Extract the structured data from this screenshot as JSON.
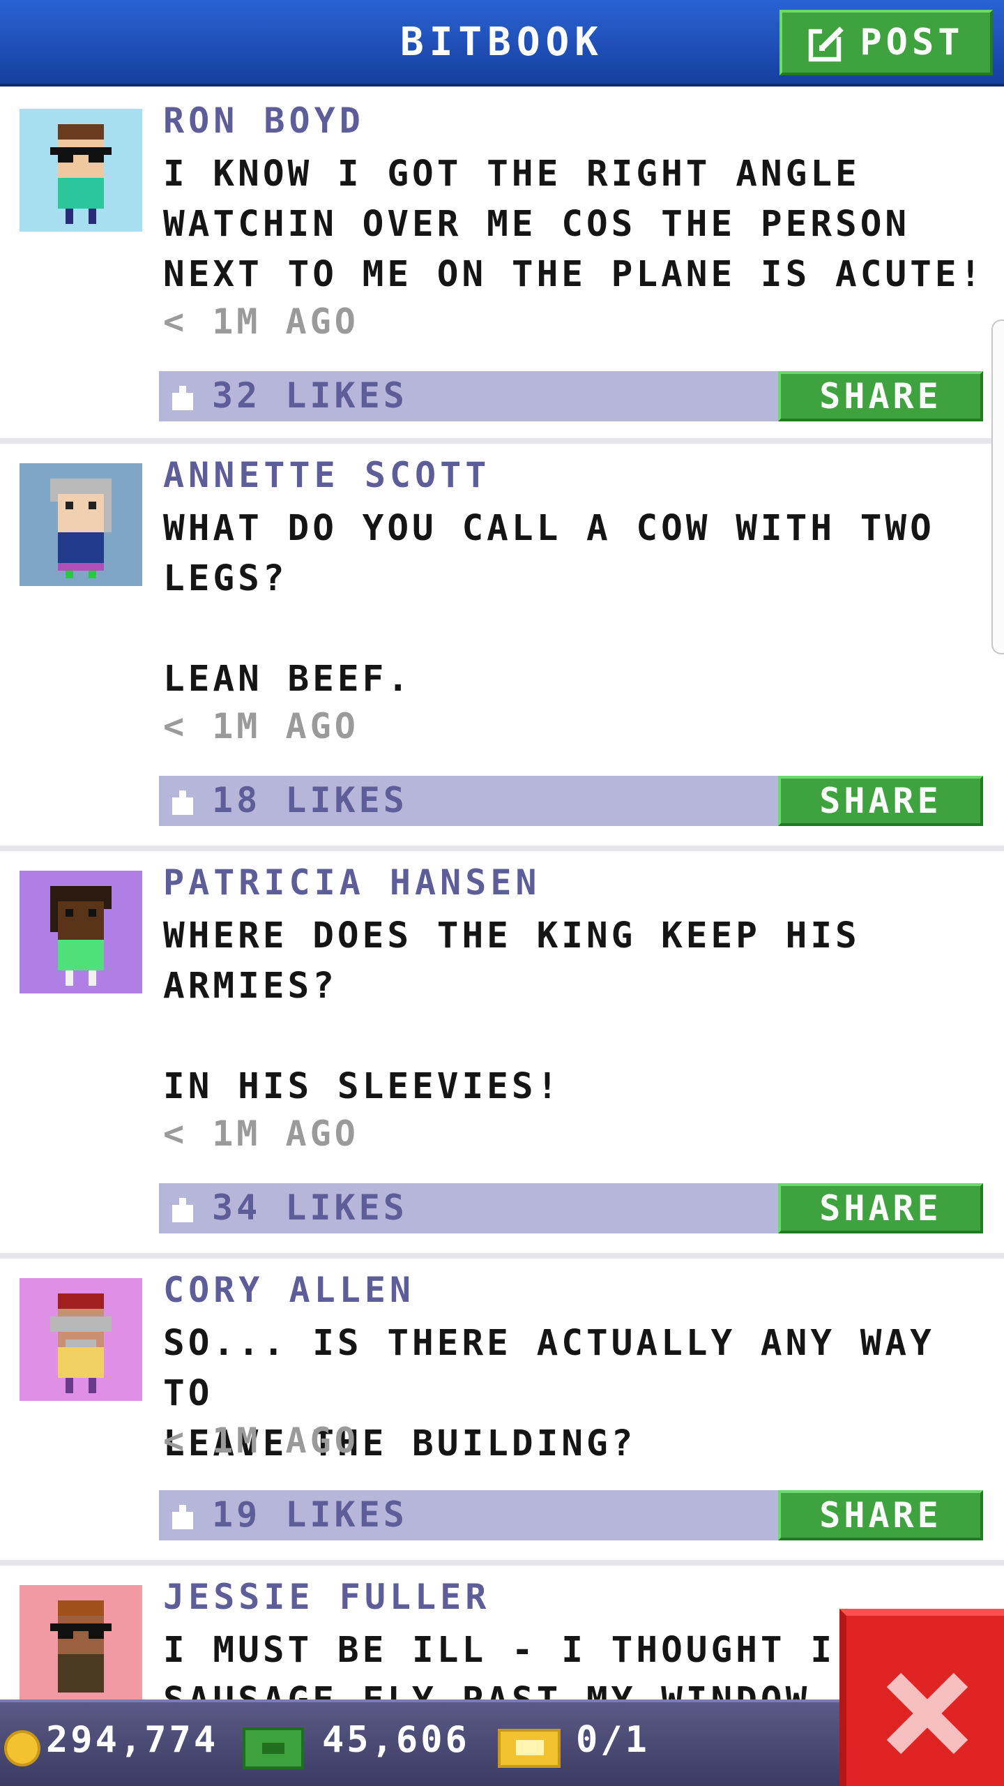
{
  "header": {
    "title": "BITBOOK",
    "post_label": "POST"
  },
  "posts": [
    {
      "author": "RON BOYD",
      "text": "I KNOW I GOT THE RIGHT ANGLE\nWATCHIN OVER ME COS THE PERSON\nNEXT TO ME ON THE PLANE IS ACUTE!",
      "time": "< 1M AGO",
      "likes": "32 LIKES",
      "share_label": "SHARE",
      "avatar_bg": "#a8dff0"
    },
    {
      "author": "ANNETTE SCOTT",
      "text": "WHAT DO YOU CALL A COW WITH TWO\nLEGS?\n\nLEAN BEEF.",
      "time": "< 1M AGO",
      "likes": "18 LIKES",
      "share_label": "SHARE",
      "avatar_bg": "#7fa6c7"
    },
    {
      "author": "PATRICIA HANSEN",
      "text": "WHERE DOES THE KING KEEP HIS\nARMIES?\n\nIN HIS SLEEVIES!",
      "time": "< 1M AGO",
      "likes": "34 LIKES",
      "share_label": "SHARE",
      "avatar_bg": "#b07fe6"
    },
    {
      "author": "CORY ALLEN",
      "text": "SO... IS THERE ACTUALLY ANY WAY TO\nLEAVE THE BUILDING?",
      "time": "< 1M AGO",
      "likes": "19 LIKES",
      "share_label": "SHARE",
      "avatar_bg": "#e08fe6"
    },
    {
      "author": "JESSIE FULLER",
      "text": "I MUST BE ILL - I THOUGHT I SAW A\nSAUSAGE FLY PAST MY WINDOW",
      "avatar_bg": "#f29aa3"
    }
  ],
  "footer": {
    "coins": "294,774",
    "bux": "45,606",
    "tickets": "0/1"
  }
}
